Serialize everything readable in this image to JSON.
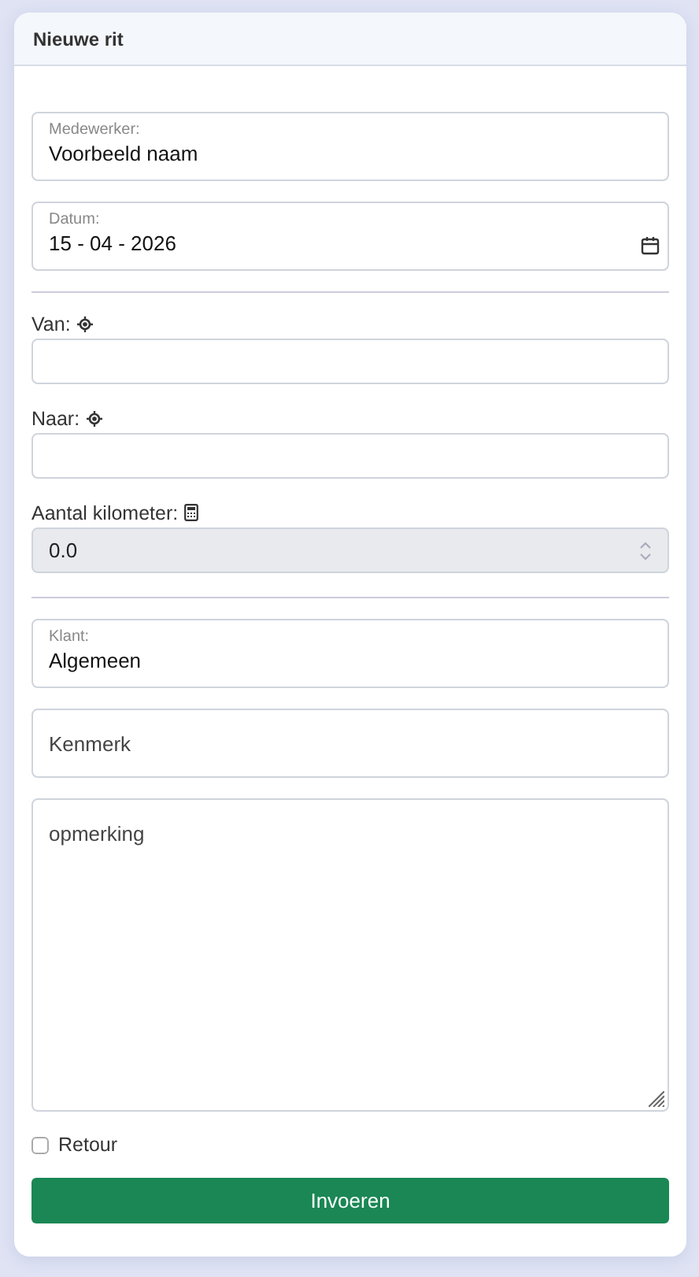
{
  "card": {
    "title": "Nieuwe rit"
  },
  "fields": [
    {
      "kind": "float-text",
      "label": "Medewerker:",
      "value": "Voorbeeld naam"
    },
    {
      "kind": "float-date",
      "label": "Datum:",
      "value": "15 - 04 - 2026"
    },
    {
      "kind": "divider"
    },
    {
      "kind": "location",
      "label": "Van:"
    },
    {
      "kind": "location",
      "label": "Naar:"
    },
    {
      "kind": "number",
      "label": "Aantal kilometer:",
      "value": "0.0",
      "disabled": true
    },
    {
      "kind": "divider"
    },
    {
      "kind": "float-text",
      "label": "Klant:",
      "value": "Algemeen"
    },
    {
      "kind": "text",
      "placeholder": "Kenmerk"
    },
    {
      "kind": "textarea",
      "placeholder": "opmerking"
    },
    {
      "kind": "checkbox",
      "label": "Retour",
      "checked": false
    },
    {
      "kind": "submit",
      "label": "Invoeren"
    }
  ]
}
